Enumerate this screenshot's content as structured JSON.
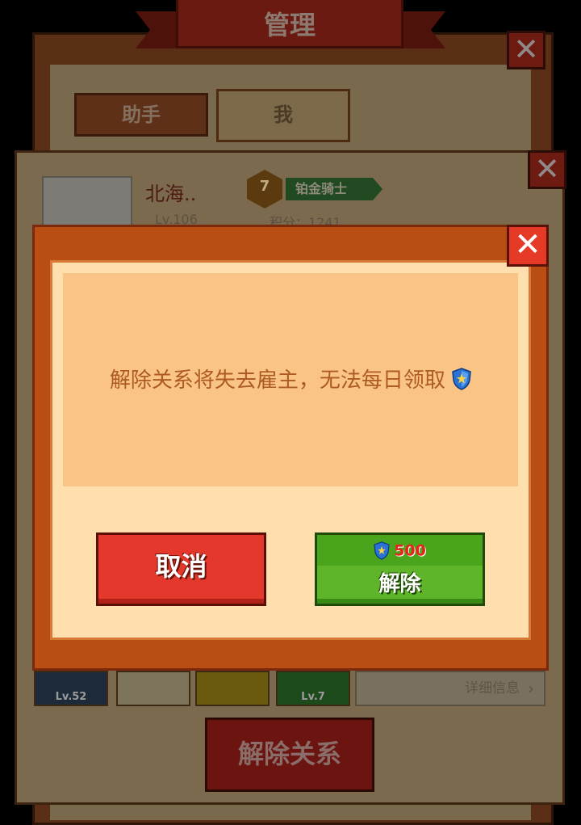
{
  "background": {
    "title": "管理",
    "tabs": [
      {
        "label": "助手"
      },
      {
        "label": "我"
      }
    ],
    "player": {
      "name": "北海..",
      "rank_number": "7",
      "rank_title": "铂金骑士",
      "level": "Lv.106",
      "score": "积分：1241"
    },
    "slots": [
      {
        "level": "Lv.52"
      },
      {
        "level": ""
      },
      {
        "level": ""
      },
      {
        "level": "Lv.7"
      }
    ],
    "detail_label": "详细信息",
    "unbind_label": "解除关系"
  },
  "dialog": {
    "message": "解除关系将失去雇主，无法每日领取",
    "cancel_label": "取消",
    "confirm_label": "解除",
    "confirm_cost": "500"
  },
  "colors": {
    "dialog_frame": "#b84e14",
    "message_text": "#ad5b22",
    "cancel_button": "#e5382c",
    "confirm_button": "#5fb52a",
    "cost_text": "#e8231a",
    "shield_blue": "#2a72d4"
  },
  "icons": {
    "close": "close-icon",
    "currency": "shield-icon"
  }
}
